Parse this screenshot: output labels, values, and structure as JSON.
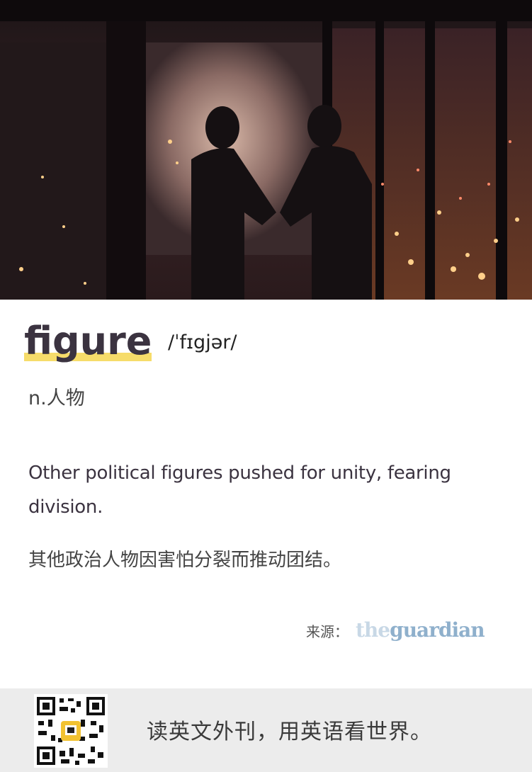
{
  "hero": {
    "alt_subject": "handshake-at-night-office"
  },
  "word": {
    "text": "figure",
    "phonetic": "/ˈfɪgjər/",
    "pos": "n.人物"
  },
  "example": {
    "en": "Other political figures pushed for unity, fearing division.",
    "zh": "其他政治人物因害怕分裂而推动团结。"
  },
  "source": {
    "label": "来源：",
    "logo_part1": "the",
    "logo_part2": "guardian"
  },
  "footer": {
    "slogan": "读英文外刊，用英语看世界。"
  },
  "colors": {
    "highlight": "#f6dc6a",
    "word": "#3b3340",
    "footer_bg": "#ececec",
    "logo": "#8fb0cc"
  },
  "icons": {
    "qr": "qr-code-icon"
  }
}
